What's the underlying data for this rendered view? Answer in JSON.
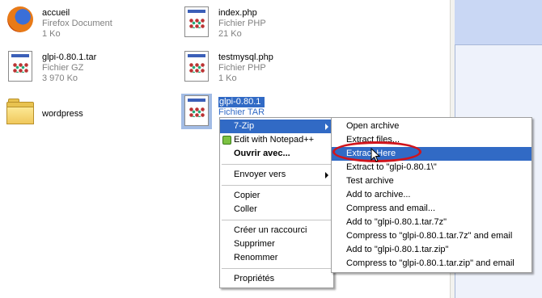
{
  "files": [
    {
      "name": "accueil",
      "type": "Firefox Document",
      "size": "1 Ko",
      "icon": "firefox-document-icon"
    },
    {
      "name": "index.php",
      "type": "Fichier PHP",
      "size": "21 Ko",
      "icon": "php-file-icon"
    },
    {
      "name": "glpi-0.80.1.tar",
      "type": "Fichier GZ",
      "size": "3 970 Ko",
      "icon": "gz-file-icon"
    },
    {
      "name": "testmysql.php",
      "type": "Fichier PHP",
      "size": "1 Ko",
      "icon": "php-file-icon"
    },
    {
      "name": "wordpress",
      "type": "",
      "size": "",
      "icon": "folder-icon"
    },
    {
      "name": "glpi-0.80.1",
      "type": "Fichier TAR",
      "size": "",
      "icon": "tar-file-icon"
    }
  ],
  "context_menu": {
    "items": [
      "7-Zip",
      "Edit with Notepad++",
      "Ouvrir avec...",
      "Envoyer vers",
      "Copier",
      "Coller",
      "Créer un raccourci",
      "Supprimer",
      "Renommer",
      "Propriétés"
    ]
  },
  "zip_menu": {
    "items": [
      "Open archive",
      "Extract files...",
      "Extract Here",
      "Extract to \"glpi-0.80.1\\\"",
      "Test archive",
      "Add to archive...",
      "Compress and email...",
      "Add to \"glpi-0.80.1.tar.7z\"",
      "Compress to \"glpi-0.80.1.tar.7z\" and email",
      "Add to \"glpi-0.80.1.tar.zip\"",
      "Compress to \"glpi-0.80.1.tar.zip\" and email"
    ]
  },
  "colors": {
    "selection": "#316ac5",
    "annotation": "#d0141c"
  }
}
